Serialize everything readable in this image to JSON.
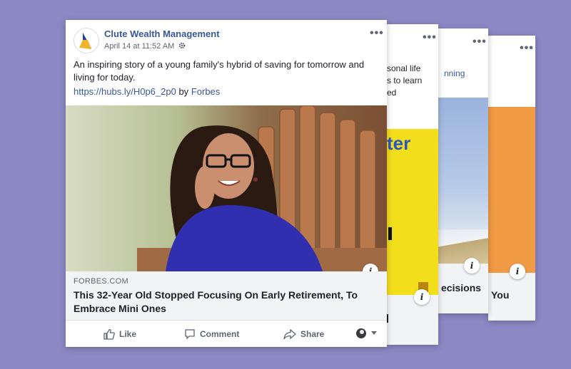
{
  "cards": {
    "front": {
      "page_name": "Clute Wealth Management",
      "date": "April 14 at 11:52 AM",
      "post_text": "An inspiring story of a young family's hybrid of saving for tomorrow and living for today.",
      "link_url": "https://hubs.ly/H0p6_2p0",
      "link_by": "by",
      "link_source": "Forbes",
      "domain": "FORBES.COM",
      "headline": "This 32-Year Old Stopped Focusing On Early Retirement, To Embrace Mini Ones",
      "actions": {
        "like": "Like",
        "comment": "Comment",
        "share": "Share"
      },
      "more": "•••",
      "info": "i"
    },
    "back1": {
      "text_lines": [
        "sonal life",
        "s to learn",
        "ed"
      ],
      "big_text": "ter",
      "more": "•••",
      "info": "i"
    },
    "back2": {
      "link_text": "nning",
      "title": "ecisions",
      "more": "•••",
      "info": "i"
    },
    "back3": {
      "title": "You",
      "more": "•••",
      "info": "i"
    }
  },
  "colors": {
    "background": "#8b89c4",
    "link": "#385898",
    "orange": "#f19b46",
    "yellow": "#f3de1c",
    "blue_text": "#2a56c4"
  }
}
